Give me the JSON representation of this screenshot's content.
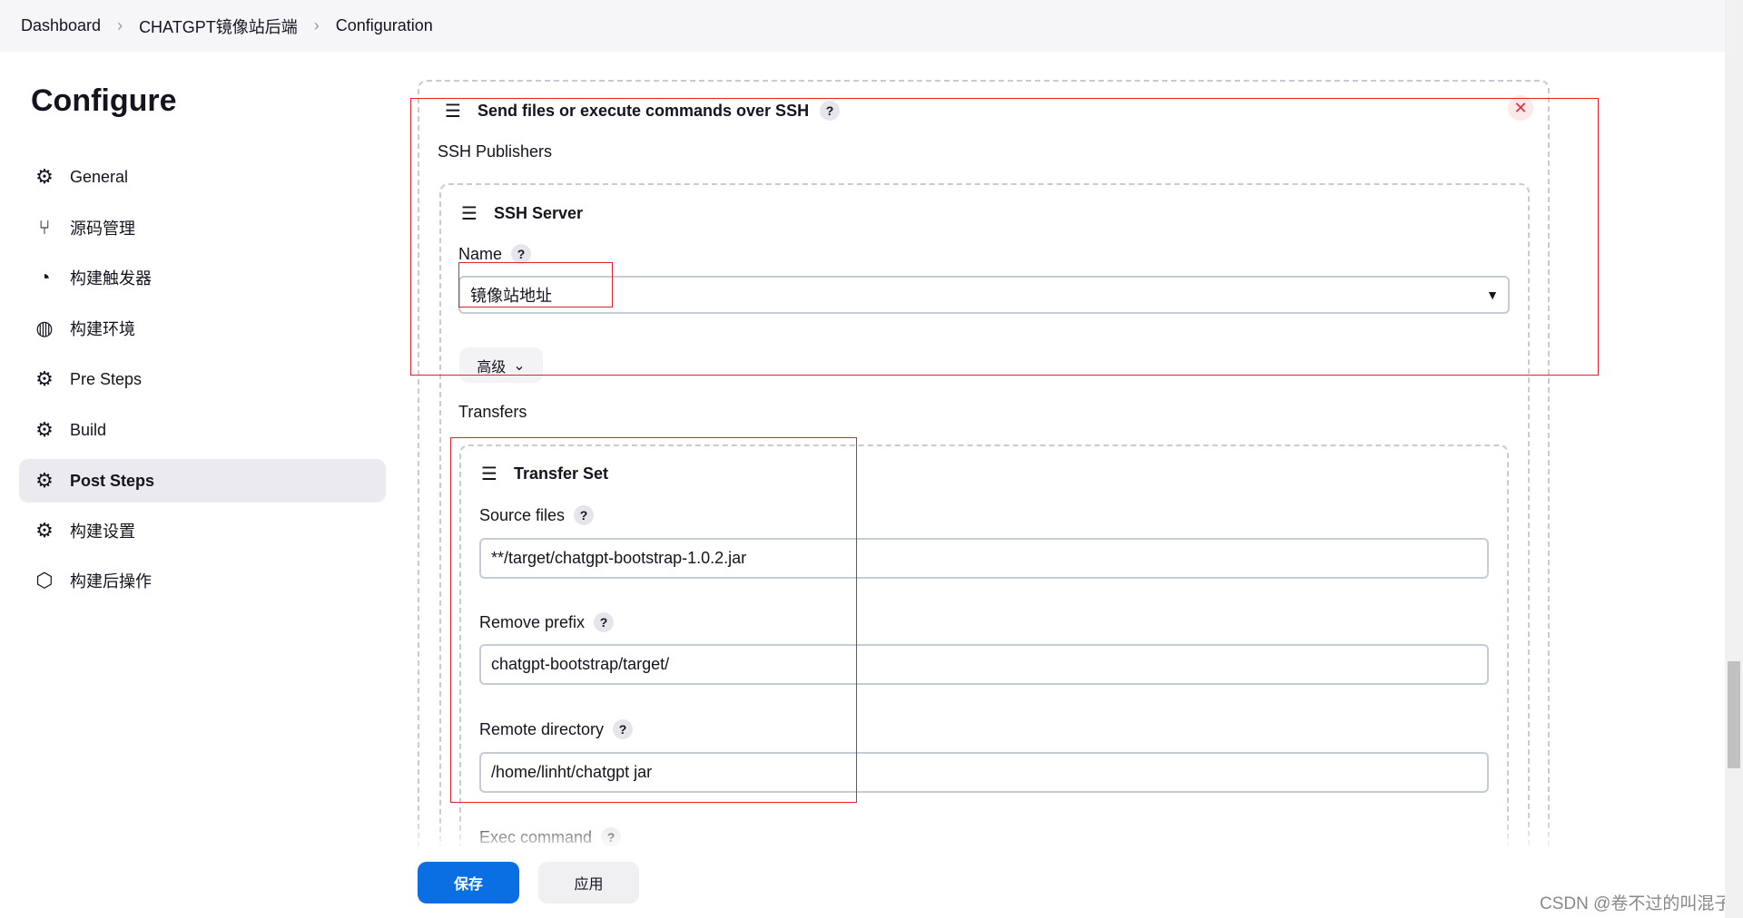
{
  "breadcrumb": [
    "Dashboard",
    "CHATGPT镜像站后端",
    "Configuration"
  ],
  "page_title": "Configure",
  "sidebar": {
    "items": [
      {
        "label": "General",
        "icon": "gear-icon"
      },
      {
        "label": "源码管理",
        "icon": "branch-icon"
      },
      {
        "label": "构建触发器",
        "icon": "timer-icon"
      },
      {
        "label": "构建环境",
        "icon": "globe-icon"
      },
      {
        "label": "Pre Steps",
        "icon": "gear-icon"
      },
      {
        "label": "Build",
        "icon": "gear-icon"
      },
      {
        "label": "Post Steps",
        "icon": "gear-icon",
        "active": true
      },
      {
        "label": "构建设置",
        "icon": "gear-icon"
      },
      {
        "label": "构建后操作",
        "icon": "package-icon"
      }
    ]
  },
  "ssh": {
    "title": "Send files or execute commands over SSH",
    "publishers_label": "SSH Publishers",
    "server": {
      "title": "SSH Server",
      "name_label": "Name",
      "name_value": "镜像站地址",
      "advanced_label": "高级"
    },
    "transfers_label": "Transfers",
    "transfer_set": {
      "title": "Transfer Set",
      "source_label": "Source files",
      "source_value": "**/target/chatgpt-bootstrap-1.0.2.jar",
      "prefix_label": "Remove prefix",
      "prefix_value": "chatgpt-bootstrap/target/",
      "remote_label": "Remote directory",
      "remote_value": "/home/linht/chatgpt jar",
      "exec_label": "Exec command"
    }
  },
  "help_glyph": "?",
  "footer": {
    "save": "保存",
    "apply": "应用"
  },
  "watermark": "CSDN @卷不过的叫混子",
  "colors": {
    "primary": "#0b6fe4",
    "annotation": "#e8202a"
  }
}
